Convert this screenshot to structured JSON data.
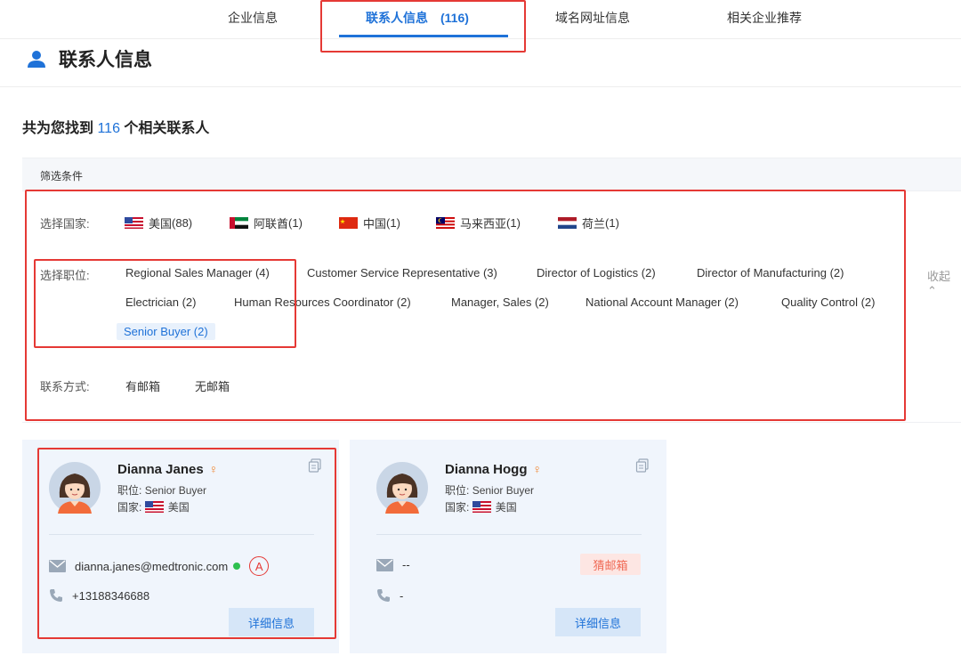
{
  "tabs": [
    {
      "label": "企业信息"
    },
    {
      "label": "联系人信息　(116)"
    },
    {
      "label": "域名网址信息"
    },
    {
      "label": "相关企业推荐"
    }
  ],
  "section": {
    "title": "联系人信息"
  },
  "summary": {
    "prefix": "共为您找到 ",
    "count": "116",
    "suffix": " 个相关联系人"
  },
  "filter": {
    "header": "筛选条件",
    "country_label": "选择国家:",
    "countries": [
      {
        "name": "美国",
        "count": "(88)",
        "flag": "us"
      },
      {
        "name": "阿联酋",
        "count": "(1)",
        "flag": "ae"
      },
      {
        "name": "中国",
        "count": "(1)",
        "flag": "cn"
      },
      {
        "name": "马来西亚",
        "count": "(1)",
        "flag": "my"
      },
      {
        "name": "荷兰",
        "count": "(1)",
        "flag": "nl"
      }
    ],
    "position_label": "选择职位:",
    "positions": [
      "Regional Sales Manager  (4)",
      "Customer Service Representative  (3)",
      "Director of Logistics  (2)",
      "Director of Manufacturing  (2)",
      "Electrician  (2)",
      "Human Resources Coordinator  (2)",
      "Manager, Sales  (2)",
      "National Account Manager  (2)",
      "Quality Control  (2)",
      "Senior Buyer  (2)"
    ],
    "selected_position": "Senior Buyer  (2)",
    "collapse_label": "收起 ⌃",
    "contact_label": "联系方式:",
    "contact_options": [
      "有邮箱",
      "无邮箱"
    ]
  },
  "contacts": [
    {
      "name": "Dianna Janes",
      "gender_symbol": "♀",
      "position_label": "职位:",
      "position": "Senior Buyer",
      "country_label": "国家:",
      "country": "美国",
      "email": "dianna.janes@medtronic.com",
      "email_status": "verified",
      "badge": "A",
      "phone": "+13188346688",
      "detail_label": "详细信息"
    },
    {
      "name": "Dianna Hogg",
      "gender_symbol": "♀",
      "position_label": "职位:",
      "position": "Senior Buyer",
      "country_label": "国家:",
      "country": "美国",
      "email": "--",
      "guess_label": "猜邮箱",
      "phone": "-",
      "detail_label": "详细信息"
    }
  ],
  "colors": {
    "accent": "#1f72d8",
    "highlight_box": "#e53935",
    "card_bg": "#f0f5fc"
  }
}
